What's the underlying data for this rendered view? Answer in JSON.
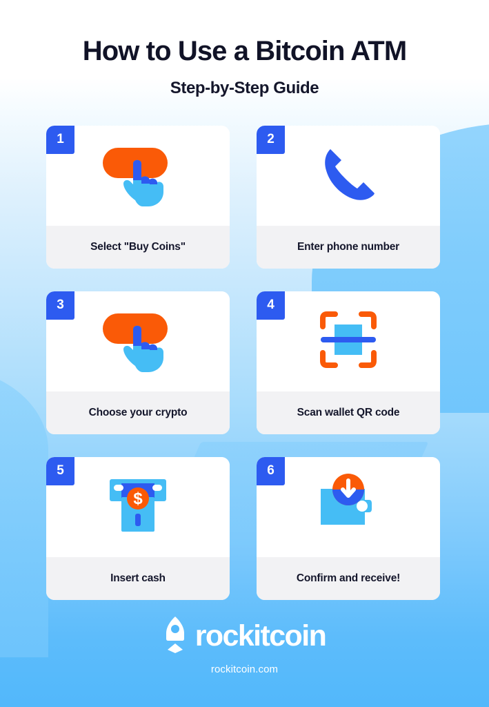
{
  "header": {
    "title": "How to Use a Bitcoin ATM",
    "subtitle": "Step-by-Step Guide"
  },
  "colors": {
    "badge_blue": "#2d5bf0",
    "accent_orange": "#fa5a07",
    "light_blue": "#45bdf5",
    "deep_blue": "#2d5bf0",
    "caption_bg": "#f2f2f4",
    "text_dark": "#14162b",
    "card_bg": "#ffffff",
    "page_bottom_blue": "#52b8fb"
  },
  "steps": [
    {
      "number": "1",
      "caption": "Select \"Buy Coins\"",
      "icon": "tap-button-icon"
    },
    {
      "number": "2",
      "caption": "Enter phone number",
      "icon": "phone-handset-icon"
    },
    {
      "number": "3",
      "caption": "Choose your crypto",
      "icon": "tap-button-icon"
    },
    {
      "number": "4",
      "caption": "Scan wallet QR code",
      "icon": "qr-scan-icon"
    },
    {
      "number": "5",
      "caption": "Insert cash",
      "icon": "atm-cash-slot-icon"
    },
    {
      "number": "6",
      "caption": "Confirm and receive!",
      "icon": "wallet-download-icon"
    }
  ],
  "footer": {
    "brand": "rockitcoin",
    "url": "rockitcoin.com",
    "logo_mark": "rockitcoin-rocket-logo-icon"
  }
}
